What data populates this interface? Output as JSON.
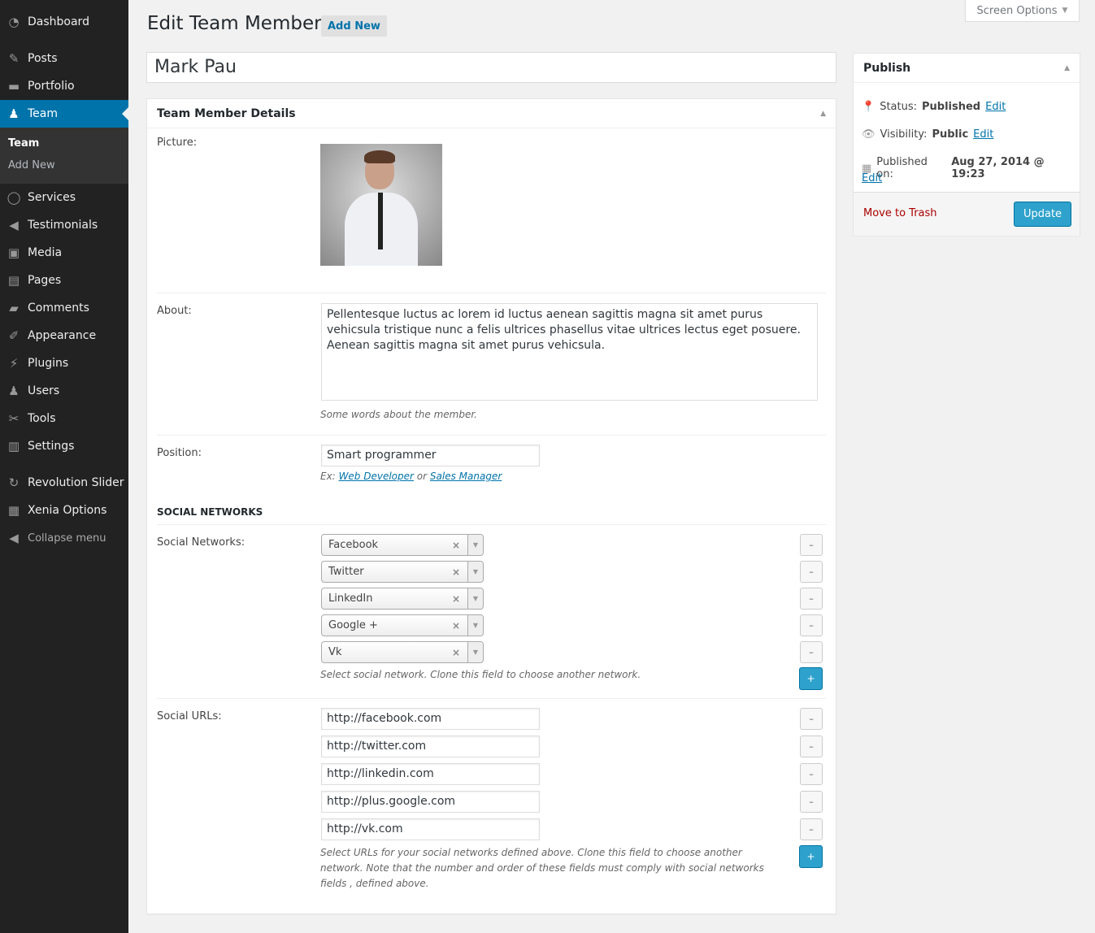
{
  "sidebar": {
    "items": [
      {
        "label": "Dashboard",
        "icon": "dashboard-icon"
      },
      {
        "label": "Posts",
        "icon": "pin-icon"
      },
      {
        "label": "Portfolio",
        "icon": "folder-icon"
      },
      {
        "label": "Team",
        "icon": "user-icon"
      },
      {
        "label": "Services",
        "icon": "circle-icon"
      },
      {
        "label": "Testimonials",
        "icon": "megaphone-icon"
      },
      {
        "label": "Media",
        "icon": "media-icon"
      },
      {
        "label": "Pages",
        "icon": "pages-icon"
      },
      {
        "label": "Comments",
        "icon": "comment-icon"
      },
      {
        "label": "Appearance",
        "icon": "brush-icon"
      },
      {
        "label": "Plugins",
        "icon": "plugin-icon"
      },
      {
        "label": "Users",
        "icon": "users-icon"
      },
      {
        "label": "Tools",
        "icon": "wrench-icon"
      },
      {
        "label": "Settings",
        "icon": "settings-icon"
      },
      {
        "label": "Revolution Slider",
        "icon": "refresh-icon"
      },
      {
        "label": "Xenia Options",
        "icon": "grid-icon"
      }
    ],
    "submenu": [
      "Team",
      "Add New"
    ],
    "collapse": "Collapse menu"
  },
  "header": {
    "screen_options": "Screen Options",
    "title": "Edit Team Member",
    "add_new": "Add New"
  },
  "post_title": "Mark Pau",
  "details": {
    "heading": "Team Member Details",
    "picture_label": "Picture:",
    "about_label": "About:",
    "about_value": "Pellentesque luctus ac lorem id luctus aenean sagittis magna sit amet purus vehicsula tristique nunc a felis ultrices phasellus vitae ultrices lectus eget posuere. Aenean sagittis magna sit amet purus vehicsula.",
    "about_desc": "Some words about the member.",
    "position_label": "Position:",
    "position_value": "Smart programmer",
    "position_desc_ex": "Ex:",
    "position_desc_link1": "Web Developer",
    "position_desc_or": "or",
    "position_desc_link2": "Sales Manager",
    "social_heading": "SOCIAL NETWORKS",
    "networks_label": "Social Networks:",
    "networks": [
      "Facebook",
      "Twitter",
      "LinkedIn",
      "Google +",
      "Vk"
    ],
    "networks_desc": "Select social network. Clone this field to choose another network.",
    "urls_label": "Social URLs:",
    "urls": [
      "http://facebook.com",
      "http://twitter.com",
      "http://linkedin.com",
      "http://plus.google.com",
      "http://vk.com"
    ],
    "urls_desc": "Select URLs for your social networks defined above. Clone this field to choose another network. Note that the number and order of these fields must comply with social networks fields , defined above.",
    "minus": "–",
    "plus": "+"
  },
  "publish": {
    "heading": "Publish",
    "status_label": "Status:",
    "status": "Published",
    "visibility_label": "Visibility:",
    "visibility": "Public",
    "published_label": "Published on:",
    "published": "Aug 27, 2014 @ 19:23",
    "edit": "Edit",
    "trash": "Move to Trash",
    "update": "Update"
  },
  "colors": {
    "accent": "#0073aa",
    "sidebar": "#222222",
    "button": "#2ea2cc",
    "trash": "#a00"
  }
}
